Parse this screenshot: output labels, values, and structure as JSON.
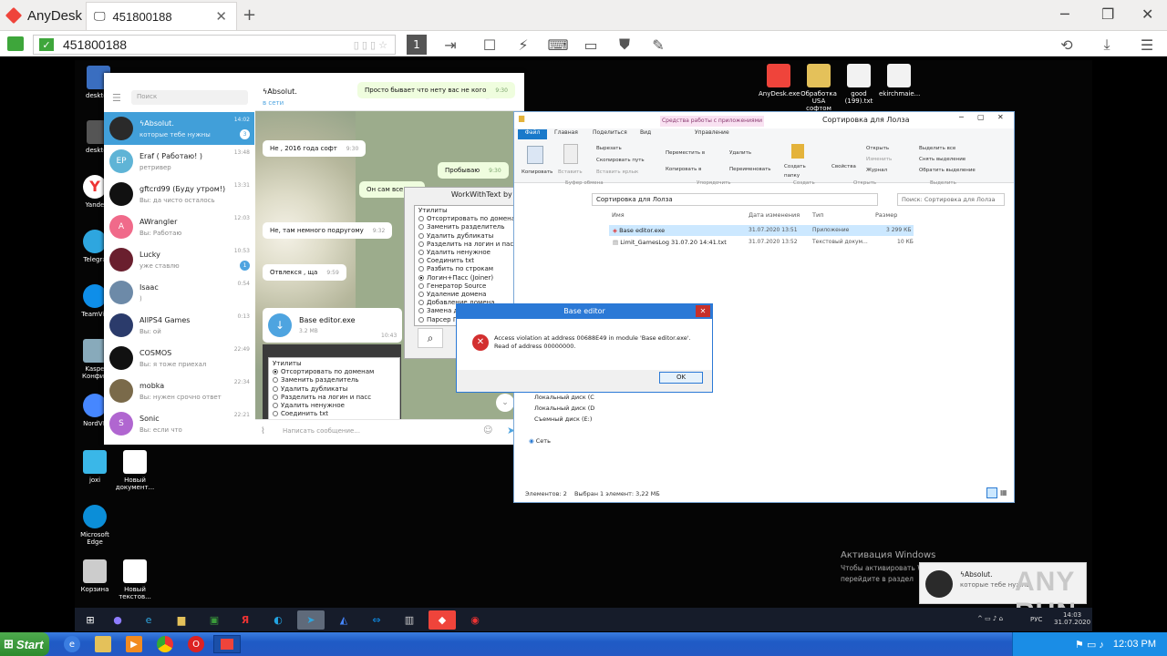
{
  "app": {
    "name": "AnyDesk",
    "tab_label": "451800188",
    "address": "451800188"
  },
  "toolbar": {
    "monitor_num": "1"
  },
  "desktop": {
    "left_icons": [
      "desktop",
      "desktop",
      "Yande",
      "Telegra",
      "TeamVie",
      "Kaspe Конфиг",
      "NordVP",
      "joxi",
      "Microsoft Edge",
      "Корзина"
    ],
    "new_doc": "Новый документ...",
    "new_text": "Новый текстов...",
    "top_icons": [
      {
        "label": "AnyDesk.exe",
        "color": "#ef443b"
      },
      {
        "label": "Обработка USA софтом",
        "color": "#e4c15a"
      },
      {
        "label": "good (199).txt",
        "color": "#f2f2f2"
      },
      {
        "label": "ekirchmaie...",
        "color": "#f2f2f2"
      }
    ],
    "watermark_title": "Активация Windows",
    "watermark_sub": "Чтобы активировать Windows, перейдите в раздел \"Параметры\" компьютера.",
    "clock_time": "14:03",
    "clock_date": "31.07.2020",
    "lang": "РУС"
  },
  "telegram": {
    "search_placeholder": "Поиск",
    "chat_title": "ϟAbsolut.",
    "chat_status": "в сети",
    "chats": [
      {
        "name": "ϟAbsolut.",
        "preview": "которые тебе нужны",
        "time": "14:02",
        "badge": "3",
        "color": "#2a2a2a",
        "initials": ""
      },
      {
        "name": "Eraf ( Работаю! )",
        "preview": "ретривер",
        "time": "13:48",
        "badge": "",
        "color": "#5fb4d6",
        "initials": "EP"
      },
      {
        "name": "gftcrd99 (Буду утром!)",
        "preview": "Вы: да чисто осталось",
        "time": "13:31",
        "badge": "",
        "color": "#111",
        "initials": ""
      },
      {
        "name": "AWrangler",
        "preview": "Вы: Работаю",
        "time": "12:03",
        "badge": "",
        "color": "#f06a8a",
        "initials": "A"
      },
      {
        "name": "Lucky",
        "preview": "уже ставлю",
        "time": "10:53",
        "badge": "1",
        "color": "#6a1f2e",
        "initials": ""
      },
      {
        "name": "Isaac",
        "preview": ")",
        "time": "0:54",
        "badge": "",
        "color": "#6d8aa8",
        "initials": ""
      },
      {
        "name": "AllPS4 Games",
        "preview": "Вы: ой",
        "time": "0:13",
        "badge": "",
        "color": "#2b3b6b",
        "initials": ""
      },
      {
        "name": "COSMOS",
        "preview": "Вы: я тоже приехал",
        "time": "22:49",
        "badge": "",
        "color": "#111",
        "initials": ""
      },
      {
        "name": "mobka",
        "preview": "Вы: нужен срочно ответ",
        "time": "22:34",
        "badge": "",
        "color": "#7a6a4a",
        "initials": ""
      },
      {
        "name": "Sonic",
        "preview": "Вы: если что",
        "time": "22:21",
        "badge": "",
        "color": "#b066d0",
        "initials": "S"
      }
    ],
    "messages": [
      {
        "text": "Просто бывает что нету вас не кого",
        "time": "9:30"
      },
      {
        "text": "Не , 2016 года софт",
        "time": "9:30"
      },
      {
        "text": "Пробываю",
        "time": "9:30"
      },
      {
        "text": "Он сам все с",
        "time": ""
      },
      {
        "text": "Не, там немного подругому",
        "time": "9:32"
      },
      {
        "text": "Отвлекся , ща",
        "time": "9:59"
      }
    ],
    "file_name": "Base editor.exe",
    "file_size": "3.2 MB",
    "file_time": "10:43",
    "input_placeholder": "Написать сообщение..."
  },
  "utils_list": [
    "Отсортировать по доменам",
    "Заменить разделитель",
    "Удалить дубликаты",
    "Разделить на логин и пасс",
    "Удалить ненужное",
    "Соединить txt",
    "Разбить по строкам",
    "Логин+Пасс (Joiner)",
    "Генератор Source",
    "Удаление домена",
    "Добавление домена",
    "Замена домена",
    "Парсер Пароля"
  ],
  "utils_group": "Утилиты",
  "wwt_title": "WorkWithText by alex ey",
  "explorer": {
    "title": "Сортировка для Лолза",
    "ctx_tab": "Средства работы с приложениями",
    "manage": "Управление",
    "tabs": [
      "Файл",
      "Главная",
      "Поделиться",
      "Вид"
    ],
    "clipboard": [
      "Копировать",
      "Вставить",
      "Вырезать",
      "Скопировать путь",
      "Вставить ярлык"
    ],
    "organize": [
      "Переместить в",
      "Копировать в",
      "Удалить",
      "Переименовать"
    ],
    "new": [
      "Создать папку"
    ],
    "open": [
      "Свойства",
      "Открыть",
      "Изменить",
      "Журнал"
    ],
    "select": [
      "Выделить все",
      "Снять выделение",
      "Обратить выделение"
    ],
    "groups": [
      "Буфер обмена",
      "Упорядочить",
      "Создать",
      "Открыть",
      "Выделить"
    ],
    "path": "Сортировка для Лолза",
    "search_placeholder": "Поиск: Сортировка для Лолза",
    "columns": [
      "Имя",
      "Дата изменения",
      "Тип",
      "Размер"
    ],
    "files": [
      {
        "name": "Base editor.exe",
        "date": "31.07.2020 13:51",
        "type": "Приложение",
        "size": "3 299 КБ"
      },
      {
        "name": "Limit_GamesLog 31.07.20 14:41.txt",
        "date": "31.07.2020 13:52",
        "type": "Текстовый докум...",
        "size": "10 КБ"
      }
    ],
    "nav": [
      "Локальный диск (C",
      "Локальный диск (D",
      "Съемный диск (E:)",
      "Сеть"
    ],
    "status_items": "Элементов: 2",
    "status_sel": "Выбран 1 элемент: 3,22 МБ"
  },
  "error": {
    "title": "Base editor",
    "message": "Access violation at address 00688E49 in module 'Base editor.exe'. Read of address 00000000.",
    "ok": "OK"
  },
  "notif": {
    "name": "ϟAbsolut.",
    "text": "которые тебе нужны"
  },
  "anyrun": "ANY RUN",
  "xp": {
    "start": "Start",
    "time": "12:03 PM"
  }
}
